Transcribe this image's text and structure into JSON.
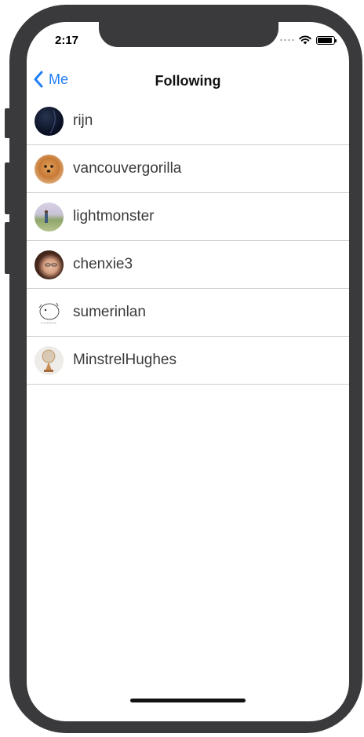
{
  "status_bar": {
    "time": "2:17"
  },
  "nav": {
    "back_label": "Me",
    "title": "Following"
  },
  "following": [
    {
      "username": "rijn",
      "avatar": "dark-night-avatar"
    },
    {
      "username": "vancouvergorilla",
      "avatar": "dog-avatar"
    },
    {
      "username": "lightmonster",
      "avatar": "landscape-avatar"
    },
    {
      "username": "chenxie3",
      "avatar": "woman-portrait-avatar"
    },
    {
      "username": "sumerinlan",
      "avatar": "hamster-sketch-avatar"
    },
    {
      "username": "MinstrelHughes",
      "avatar": "trophy-avatar"
    }
  ],
  "colors": {
    "accent": "#1f7ef5",
    "frame": "#3a3a3c",
    "separator": "#cfcfcf"
  }
}
